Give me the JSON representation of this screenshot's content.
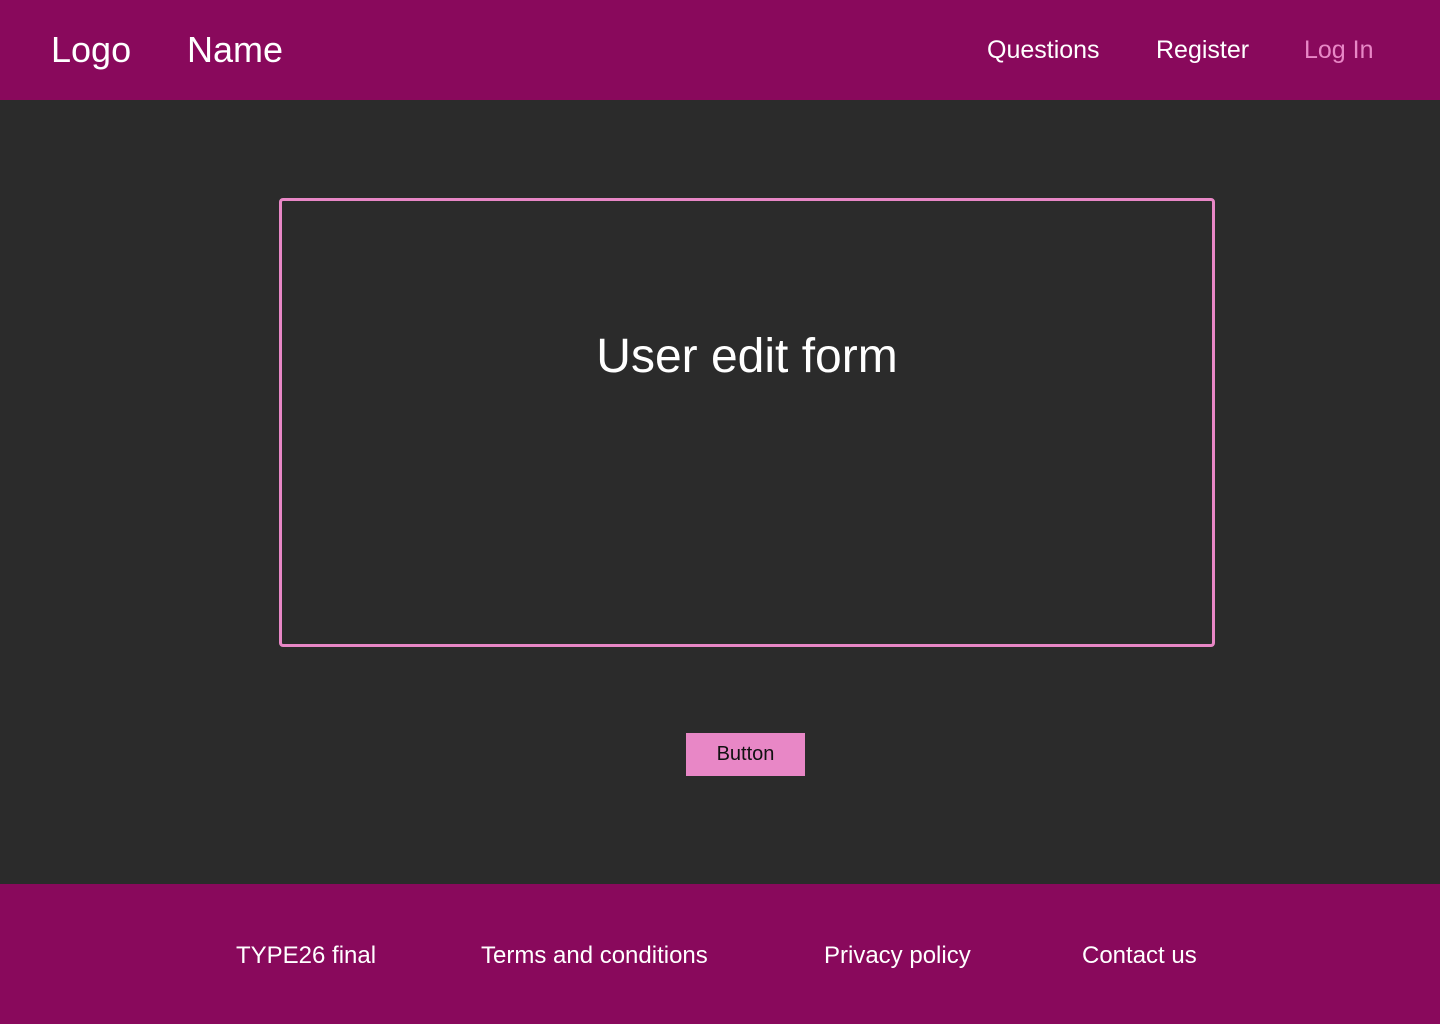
{
  "header": {
    "logo": "Logo",
    "name": "Name",
    "nav": {
      "questions": "Questions",
      "register": "Register",
      "login": "Log In"
    }
  },
  "main": {
    "form_title": "User edit form",
    "button": "Button"
  },
  "footer": {
    "type": "TYPE26 final",
    "terms": "Terms and conditions",
    "privacy": "Privacy policy",
    "contact": "Contact us"
  }
}
